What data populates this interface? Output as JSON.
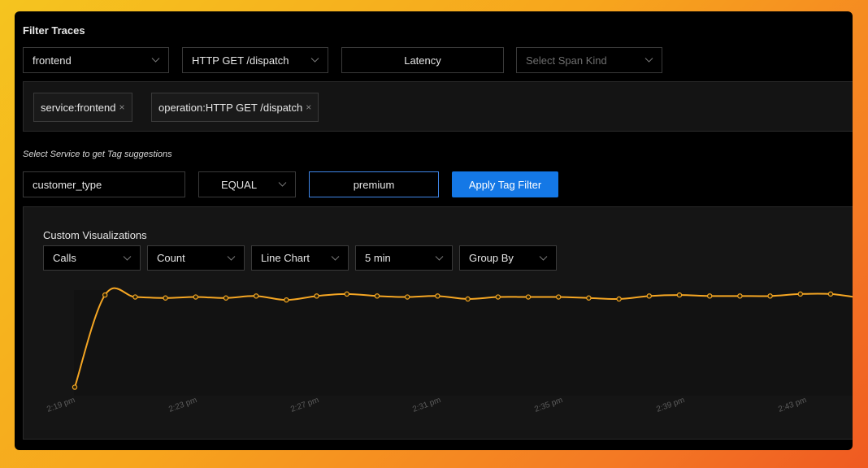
{
  "filters": {
    "title": "Filter Traces",
    "service": "frontend",
    "operation": "HTTP GET /dispatch",
    "latency_label": "Latency",
    "span_kind_placeholder": "Select Span Kind"
  },
  "tags": [
    {
      "label": "service:frontend",
      "remove": "×"
    },
    {
      "label": "operation:HTTP GET /dispatch",
      "remove": "×"
    }
  ],
  "tag_filter": {
    "hint": "Select Service to get Tag suggestions",
    "key": "customer_type",
    "operator": "EQUAL",
    "value": "premium",
    "apply_label": "Apply Tag Filter"
  },
  "viz": {
    "title": "Custom Visualizations",
    "metric": "Calls",
    "aggregation": "Count",
    "chart_type": "Line Chart",
    "interval": "5 min",
    "group_by": "Group By"
  },
  "colors": {
    "line": "#f5a623",
    "accent": "#1478e6"
  },
  "chart_data": {
    "type": "line",
    "title": "",
    "xlabel": "",
    "ylabel": "",
    "x": [
      "2:19 pm",
      "",
      "",
      "",
      "",
      "",
      "",
      "",
      "",
      "",
      "",
      "",
      "",
      "",
      "",
      "",
      "",
      "",
      "",
      "",
      "",
      "",
      "",
      "",
      "",
      "",
      "",
      "",
      "",
      "",
      "",
      "",
      "",
      "",
      "",
      "",
      "",
      "",
      "",
      "",
      "",
      "",
      "",
      "",
      "",
      "",
      "",
      "",
      "",
      ""
    ],
    "x_tick_labels": [
      "2:19 pm",
      "2:23 pm",
      "2:27 pm",
      "2:31 pm",
      "2:35 pm",
      "2:39 pm",
      "2:43 pm"
    ],
    "series": [
      {
        "name": "",
        "values": [
          2,
          95,
          93,
          92,
          93,
          92,
          94,
          90,
          94,
          96,
          94,
          93,
          94,
          91,
          93,
          93,
          93,
          92,
          91,
          94,
          95,
          94,
          94,
          94,
          96,
          96,
          92
        ]
      }
    ],
    "ylim": [
      0,
      100
    ],
    "grid": false,
    "legend": "none"
  }
}
